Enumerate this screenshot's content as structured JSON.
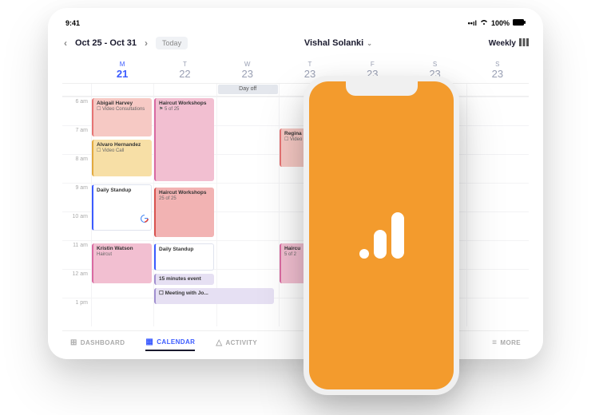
{
  "status": {
    "time": "9:41",
    "signal": "••ıl",
    "wifi": "⌔",
    "battery": "100%"
  },
  "nav": {
    "range": "Oct 25 - Oct 31",
    "today": "Today",
    "person": "Vishal Solanki",
    "view": "Weekly"
  },
  "days": [
    {
      "dow": "M",
      "num": "21",
      "active": true
    },
    {
      "dow": "T",
      "num": "22"
    },
    {
      "dow": "W",
      "num": "23"
    },
    {
      "dow": "T",
      "num": "23"
    },
    {
      "dow": "F",
      "num": "23"
    },
    {
      "dow": "S",
      "num": "23"
    },
    {
      "dow": "S",
      "num": "23"
    }
  ],
  "allday": {
    "day2_label": "Day off"
  },
  "time_labels": [
    "6 am",
    "7 am",
    "8 am",
    "9 am",
    "10 am",
    "11 am",
    "12 am",
    "1 pm"
  ],
  "events": {
    "e0": {
      "title": "Abigail Harvey",
      "sub": "☐ Video Consultations"
    },
    "e1": {
      "title": "Alvaro Hernandez",
      "sub": "☐ Video Call"
    },
    "e2": {
      "title": "Daily Standup",
      "sub": ""
    },
    "e3": {
      "title": "Kristin Watson",
      "sub": "Haircut"
    },
    "e4": {
      "title": "Haircut Workshops",
      "sub": "⚑ 5 of 25"
    },
    "e5": {
      "title": "Haircut Workshops",
      "sub": "25 of 25"
    },
    "e6": {
      "title": "Daily Standup",
      "sub": ""
    },
    "e7": {
      "title": "15 minutes event",
      "sub": ""
    },
    "e8": {
      "title": "☐ Meeting with Jo...",
      "sub": ""
    },
    "e9": {
      "title": "Regina",
      "sub": "☐ Video C"
    },
    "e10": {
      "title": "Haircu",
      "sub": "5 of 2"
    }
  },
  "tabs": {
    "dashboard": "DASHBOARD",
    "calendar": "CALENDAR",
    "activity": "ACTIVITY",
    "more": "MORE"
  }
}
